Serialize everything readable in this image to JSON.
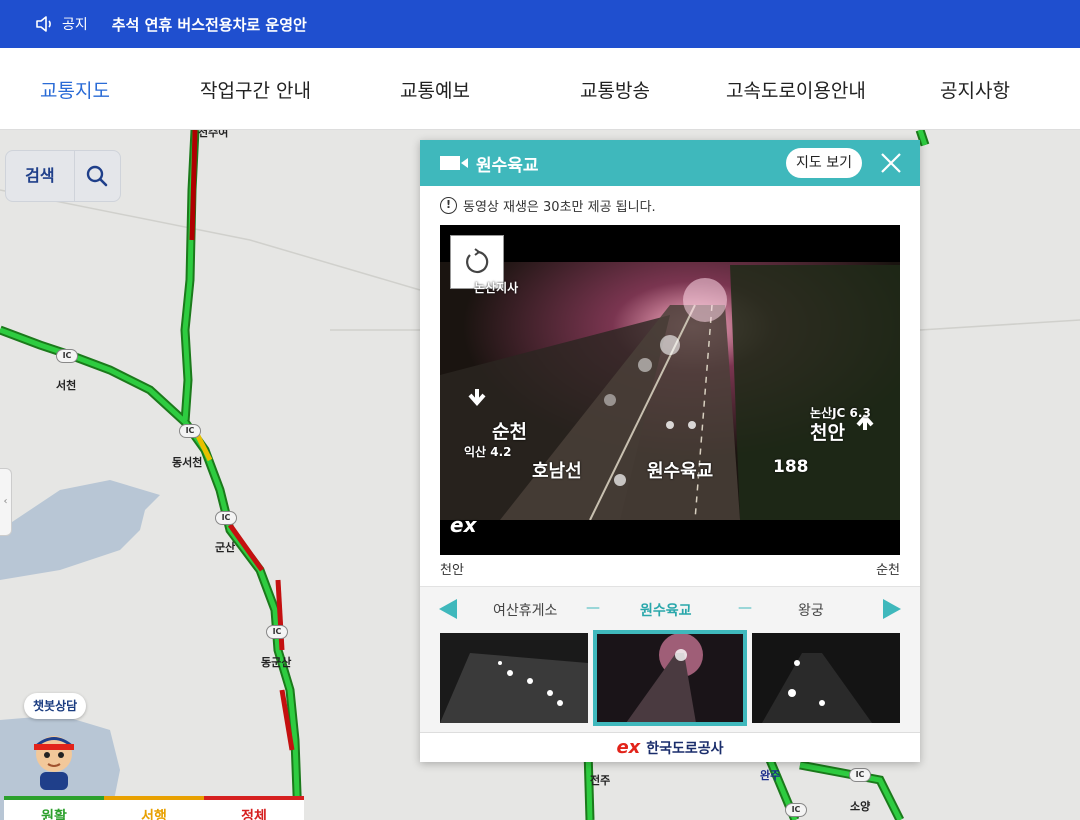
{
  "notice": {
    "label": "공지",
    "text": "추석 연휴 버스전용차로 운영안"
  },
  "nav": {
    "items": [
      "교통지도",
      "작업구간 안내",
      "교통예보",
      "교통방송",
      "고속도로이용안내",
      "공지사항"
    ]
  },
  "search": {
    "label": "검색"
  },
  "map": {
    "labels": [
      "서천",
      "동서천",
      "군산",
      "동군산",
      "전주",
      "완주",
      "소양",
      "천수여"
    ],
    "ic": "IC"
  },
  "chatbot": {
    "label": "챗봇상담"
  },
  "legend": {
    "smooth": "원활",
    "slow": "서행",
    "jam": "정체"
  },
  "colors": {
    "accent": "#3fb8bc",
    "smooth": "#2ca02c",
    "slow": "#e8a000",
    "jam": "#d62020",
    "header": "#1f4fcf"
  },
  "cctv": {
    "title": "원수육교",
    "map_button": "지도 보기",
    "notice": "동영상 재생은 30초만 제공 됩니다.",
    "overlay": {
      "station": "논산지사",
      "left_dir": "순천",
      "left_sub": "익산 4.2",
      "right_top": "논산JC 6.3",
      "right_dir": "천안",
      "line": "호남선",
      "place": "원수육교",
      "km": "188",
      "logo": "ex"
    },
    "dir_left": "천안",
    "dir_right": "순천",
    "prev": "여산휴게소",
    "current": "원수육교",
    "next": "왕궁",
    "separator": "—",
    "footer_logo": "ex",
    "footer": "한국도로공사"
  }
}
